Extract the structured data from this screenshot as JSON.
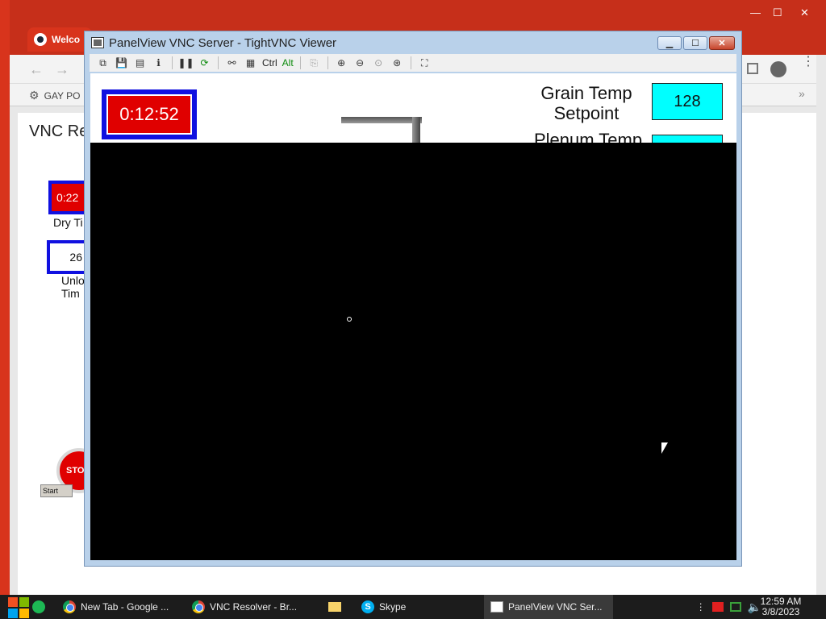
{
  "browser_bg": {
    "tab_title": "Welco",
    "bookmark": "GAY PO",
    "page_heading": "VNC Re",
    "dry_timer_value": "0:22",
    "dry_timer_label": "Dry Ti",
    "unload_value": "26",
    "unload_label_line1": "Unlo",
    "unload_label_line2": "Tim",
    "stop_label": "STO",
    "start_label": "Start"
  },
  "vnc": {
    "title": "PanelView VNC Server - TightVNC Viewer",
    "toolbar": {
      "ctrl_label": "Ctrl",
      "alt_label": "Alt"
    },
    "hmi": {
      "timer": "0:12:52",
      "grain_label_line1": "Grain Temp",
      "grain_label_line2": "Setpoint",
      "grain_value": "128",
      "plenum_label": "Plenum Temp"
    }
  },
  "taskbar": {
    "apps": [
      {
        "label": "New Tab - Google ...",
        "icon": "chrome-icon"
      },
      {
        "label": "VNC Resolver - Br...",
        "icon": "chrome-icon"
      },
      {
        "label": "",
        "icon": "folder-icon"
      },
      {
        "label": "Skype",
        "icon": "skype-icon"
      },
      {
        "label": "PanelView VNC Ser...",
        "icon": "vnc-icon"
      }
    ],
    "time": "12:59 AM",
    "date": "3/8/2023"
  }
}
